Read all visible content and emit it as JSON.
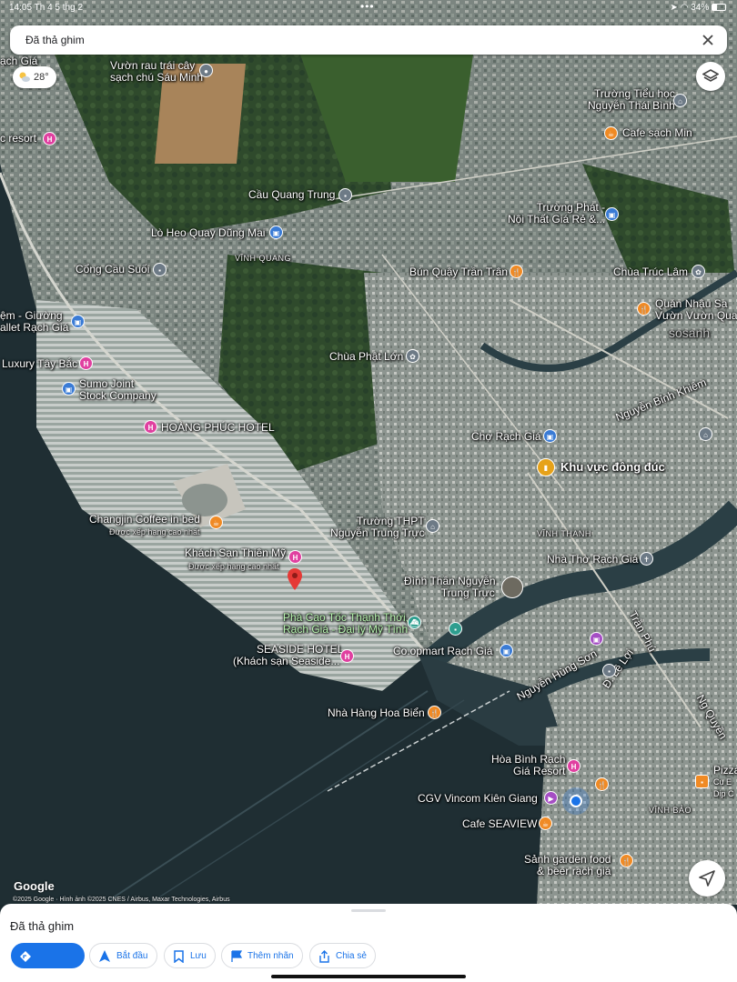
{
  "status_bar": {
    "time": "14:05",
    "date": "Th 4 5 thg 2",
    "dots": "•••",
    "battery": "34%"
  },
  "top_card": {
    "title": "Đã thả ghim"
  },
  "weather": {
    "temp": "28°"
  },
  "map_labels": {
    "vuon_rau": [
      "Vườn rau trái cây",
      "sạch chú Sáu Minh"
    ],
    "c_resort": "c resort",
    "rach_gia_top": "ạch Giá",
    "truong_tieu_hoc": [
      "Trường Tiểu học",
      "Nguyễn Thái Bình"
    ],
    "cafe_sach": "Cafe sạch Min",
    "cau_quang_trung": "Cầu Quang Trung",
    "truong_phat": [
      "Trường Phát -",
      "Nội Thất Giá Rẻ &..."
    ],
    "lo_heo": "Lò Heo Quay Dũng Mai",
    "vinh_quang": "VĨNH QUANG",
    "cong_cau_suoi": "Cổng Cầu Suối",
    "bun_quay": "Bún Quậy Trần Trân",
    "chua_truc_lam": "Chùa Trúc Lâm",
    "quan_nhau": [
      "Quán Nhậu Sa",
      "Vườn Vườn Qua"
    ],
    "nem_giuong": [
      "ệm - Giường",
      "allet Rạch Giá"
    ],
    "chua_phat_lon": "Chùa Phật Lớn",
    "luxury_tay_bac": "Luxury Tây Bắc",
    "sumo_joint": [
      "Sumo Joint",
      "Stock Company"
    ],
    "hoang_phuc": "HOÀNG PHÚC HOTEL",
    "nguyen_binh_khiem": "Nguyễn Bỉnh Khiêm",
    "cho_rach_gia": "Chợ Rạch Giá",
    "khu_vuc_dong_duc": "Khu vực đông đúc",
    "changjin": "Changjin Coffee in bed",
    "changjin_sub": "Được xếp hạng cao nhất",
    "truong_thpt": [
      "Trường THPT",
      "Nguyễn Trung Trực"
    ],
    "vinh_thanh": "VĨNH THANH",
    "khach_san_thien_my": "Khách Sạn Thiên Mỹ",
    "thien_my_sub": "Được xếp hạng cao nhất",
    "nha_tho": "Nhà Thờ Rạch Giá",
    "dinh_than": [
      "Đình Thần Nguyễn",
      "Trung Trực"
    ],
    "pha_cao_toc": [
      "Phà Cao Tốc Thạnh Thới,",
      "Rạch Giá - Đại lý Mỹ Tình"
    ],
    "tran_phu": "Trần Phú",
    "seaside_hotel": [
      "SEASIDE HOTEL",
      "(Khách sạn Seaside..."
    ],
    "coopmart": "Co.opmart Rạch Giá",
    "nguyen_hung_son": "Nguyễn Hùng Sơn",
    "d_le_loi": "Đ. Lê Lợi",
    "nha_hang_hoa_bien": "Nhà Hàng Hoa Biển",
    "ng_quyen": "Ng Quyền",
    "hoa_binh": [
      "Hòa Bình Rạch",
      "Giá Resort"
    ],
    "pizza": [
      "Pizza",
      "Cụ E",
      "Dịp C"
    ],
    "cgv": "CGV Vincom Kiên Giang",
    "vinh_bao": "VĨNH BẢO",
    "cafe_seaview": "Cafe SEAVIEW",
    "sanh_garden": [
      "Sảnh garden food",
      "& beer rạch giá"
    ],
    "watermark": "sosanh"
  },
  "branding": {
    "google": "Google",
    "attribution": "©2025 Google · Hình ảnh ©2025 CNES / Airbus, Maxar Technologies, Airbus"
  },
  "sheet": {
    "title": "Đã thả ghim",
    "chips": {
      "directions": "",
      "start": "Bắt đầu",
      "save": "Lưu",
      "add_label": "Thêm nhãn",
      "share": "Chia sẻ"
    }
  },
  "colors": {
    "accent": "#1a73e8",
    "pin_red": "#e53935",
    "hotel_pink": "#e040a0"
  }
}
